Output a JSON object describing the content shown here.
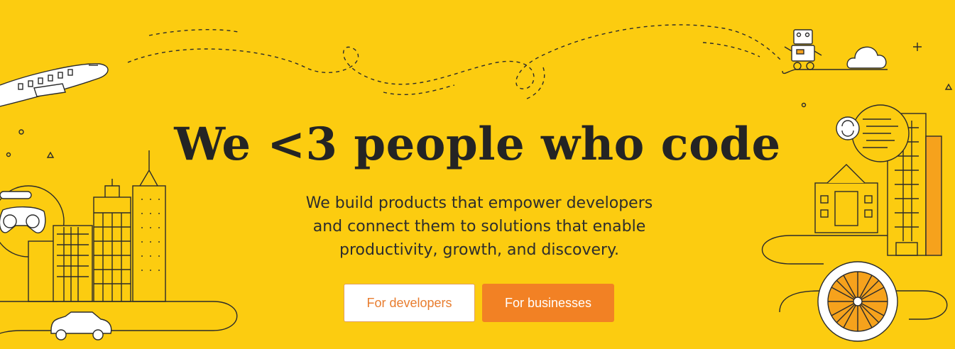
{
  "hero": {
    "headline": "We <3 people who code",
    "subtext": "We build products that empower developers and connect them to solutions that enable productivity, growth, and discovery.",
    "buttons": {
      "developers": "For developers",
      "businesses": "For businesses"
    }
  },
  "colors": {
    "background": "#fccc10",
    "primary_button": "#f28124",
    "secondary_button_text": "#e87d2f",
    "headline": "#242424"
  },
  "illustrations": [
    "airplane",
    "robot",
    "cloud",
    "city-skyline",
    "game-controller",
    "car",
    "office-buildings",
    "sync-icon",
    "ferris-wheel"
  ]
}
